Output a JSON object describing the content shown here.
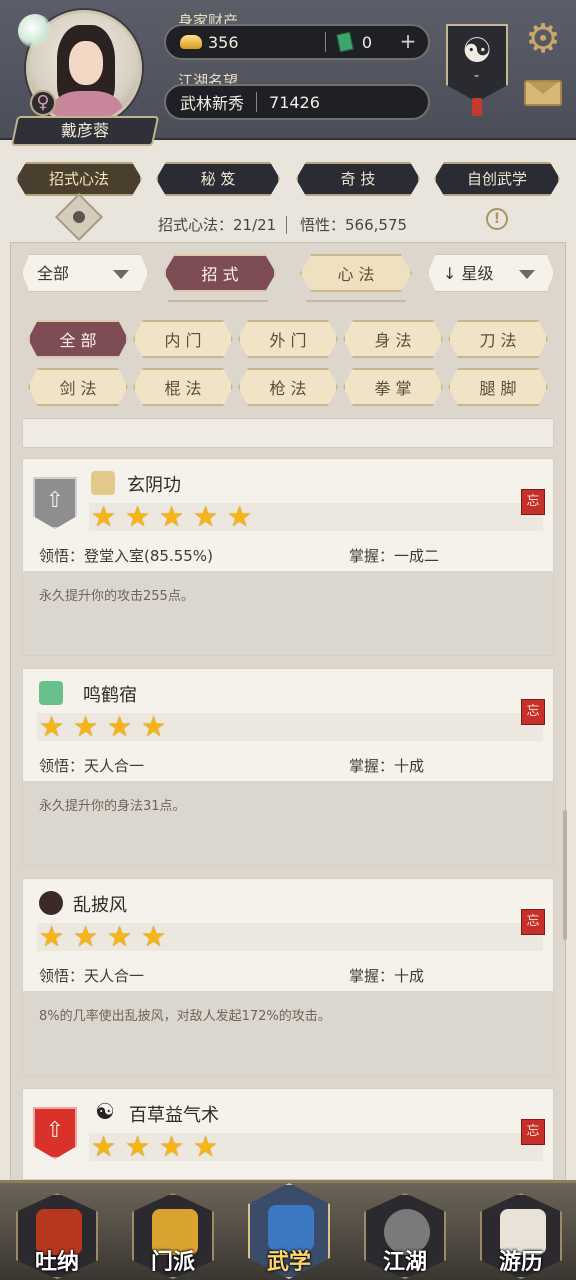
{
  "player": {
    "name": "戴彦蓉",
    "gender_icon": "♀",
    "wealth_label": "身家财产",
    "gold": "356",
    "jade": "0",
    "fame_label": "江湖名望",
    "fame_title": "武林新秀",
    "fame_value": "71426",
    "emblem_value": "-"
  },
  "main_tabs": [
    {
      "label": "招式心法",
      "active": true
    },
    {
      "label": "秘 笈"
    },
    {
      "label": "奇 技"
    },
    {
      "label": "自创武学"
    }
  ],
  "stats": {
    "moves": "招式心法：21/21",
    "insight": "悟性：566,575"
  },
  "filters": {
    "left_dropdown": "全部",
    "pills": [
      "招 式",
      "心 法"
    ],
    "sort_dropdown": "星级",
    "sort_arrow": "↓"
  },
  "categories": [
    "全 部",
    "内 门",
    "外 门",
    "身 法",
    "刀 法",
    "剑 法",
    "棍 法",
    "枪 法",
    "拳 掌",
    "腿 脚"
  ],
  "skills": [
    {
      "name": "玄阴功",
      "stars": 5,
      "insight_label": "领悟：",
      "insight_value": "登堂入室(85.55%)",
      "mastery_label": "掌握：",
      "mastery_value": "一成二",
      "description": "永久提升你的攻击255点。",
      "rank_badge": "silver-arrow-badge",
      "type_icon": "ram-skull-icon"
    },
    {
      "name": "鸣鹤宿",
      "stars": 4,
      "insight_label": "领悟：",
      "insight_value": "天人合一",
      "mastery_label": "掌握：",
      "mastery_value": "十成",
      "description": "永久提升你的身法31点。",
      "type_icon": "green-wing-icon"
    },
    {
      "name": "乱披风",
      "stars": 4,
      "insight_label": "领悟：",
      "insight_value": "天人合一",
      "mastery_label": "掌握：",
      "mastery_value": "十成",
      "description": "8%的几率使出乱披风，对敌人发起172%的攻击。",
      "type_icon": "fire-orb-icon"
    },
    {
      "name": "百草益气术",
      "stars": 4,
      "rank_badge": "red-arrow-badge",
      "type_icon": "yinyang-icon"
    }
  ],
  "forget_icon_text": "忘",
  "bottom_nav": [
    {
      "label": "吐纳"
    },
    {
      "label": "门派"
    },
    {
      "label": "武学",
      "active": true
    },
    {
      "label": "江湖"
    },
    {
      "label": "游历"
    }
  ],
  "colors": {
    "accent_active": "#7d4c55",
    "star": "#f6b417",
    "header_bg": "#4b4e58"
  }
}
